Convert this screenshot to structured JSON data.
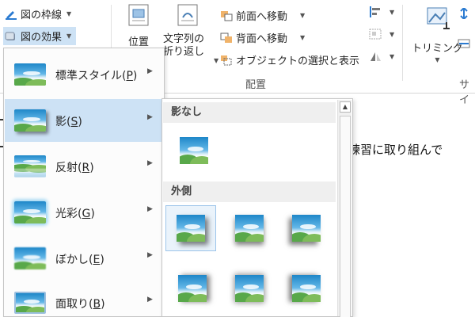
{
  "ribbon": {
    "picture_border_label": "図の枠線",
    "picture_effects_label": "図の効果",
    "position_label": "位置",
    "wrap_text_label_line1": "文字列の",
    "wrap_text_label_line2": "折り返し",
    "bring_forward_label": "前面へ移動",
    "send_backward_label": "背面へ移動",
    "selection_pane_label": "オブジェクトの選択と表示",
    "arrange_group_label": "配置",
    "crop_label": "トリミング",
    "size_group_label_partial": "サイ"
  },
  "document": {
    "visible_text": "練習に取り組んで"
  },
  "effects_menu": {
    "items": [
      {
        "label": "標準スタイル",
        "key": "P",
        "icon": "preset-icon"
      },
      {
        "label": "影",
        "key": "S",
        "icon": "shadow-icon",
        "active": true
      },
      {
        "label": "反射",
        "key": "R",
        "icon": "reflection-icon"
      },
      {
        "label": "光彩",
        "key": "G",
        "icon": "glow-icon"
      },
      {
        "label": "ぼかし",
        "key": "E",
        "icon": "soft-edges-icon"
      },
      {
        "label": "面取り",
        "key": "B",
        "icon": "bevel-icon"
      }
    ]
  },
  "shadow_submenu": {
    "no_shadow_header": "影なし",
    "outer_header": "外側",
    "presets": [
      {
        "name": "no-shadow",
        "selected": false
      },
      {
        "name": "outer-shadow-1",
        "selected": true
      },
      {
        "name": "outer-shadow-2",
        "selected": false
      },
      {
        "name": "outer-shadow-3",
        "selected": false
      },
      {
        "name": "outer-shadow-4",
        "selected": false
      },
      {
        "name": "outer-shadow-5",
        "selected": false
      },
      {
        "name": "outer-shadow-6",
        "selected": false
      }
    ]
  },
  "colors": {
    "active_item_bg": "#cde2f5",
    "selected_preset_border": "#9dc5ea",
    "header_bg": "#efefef"
  }
}
